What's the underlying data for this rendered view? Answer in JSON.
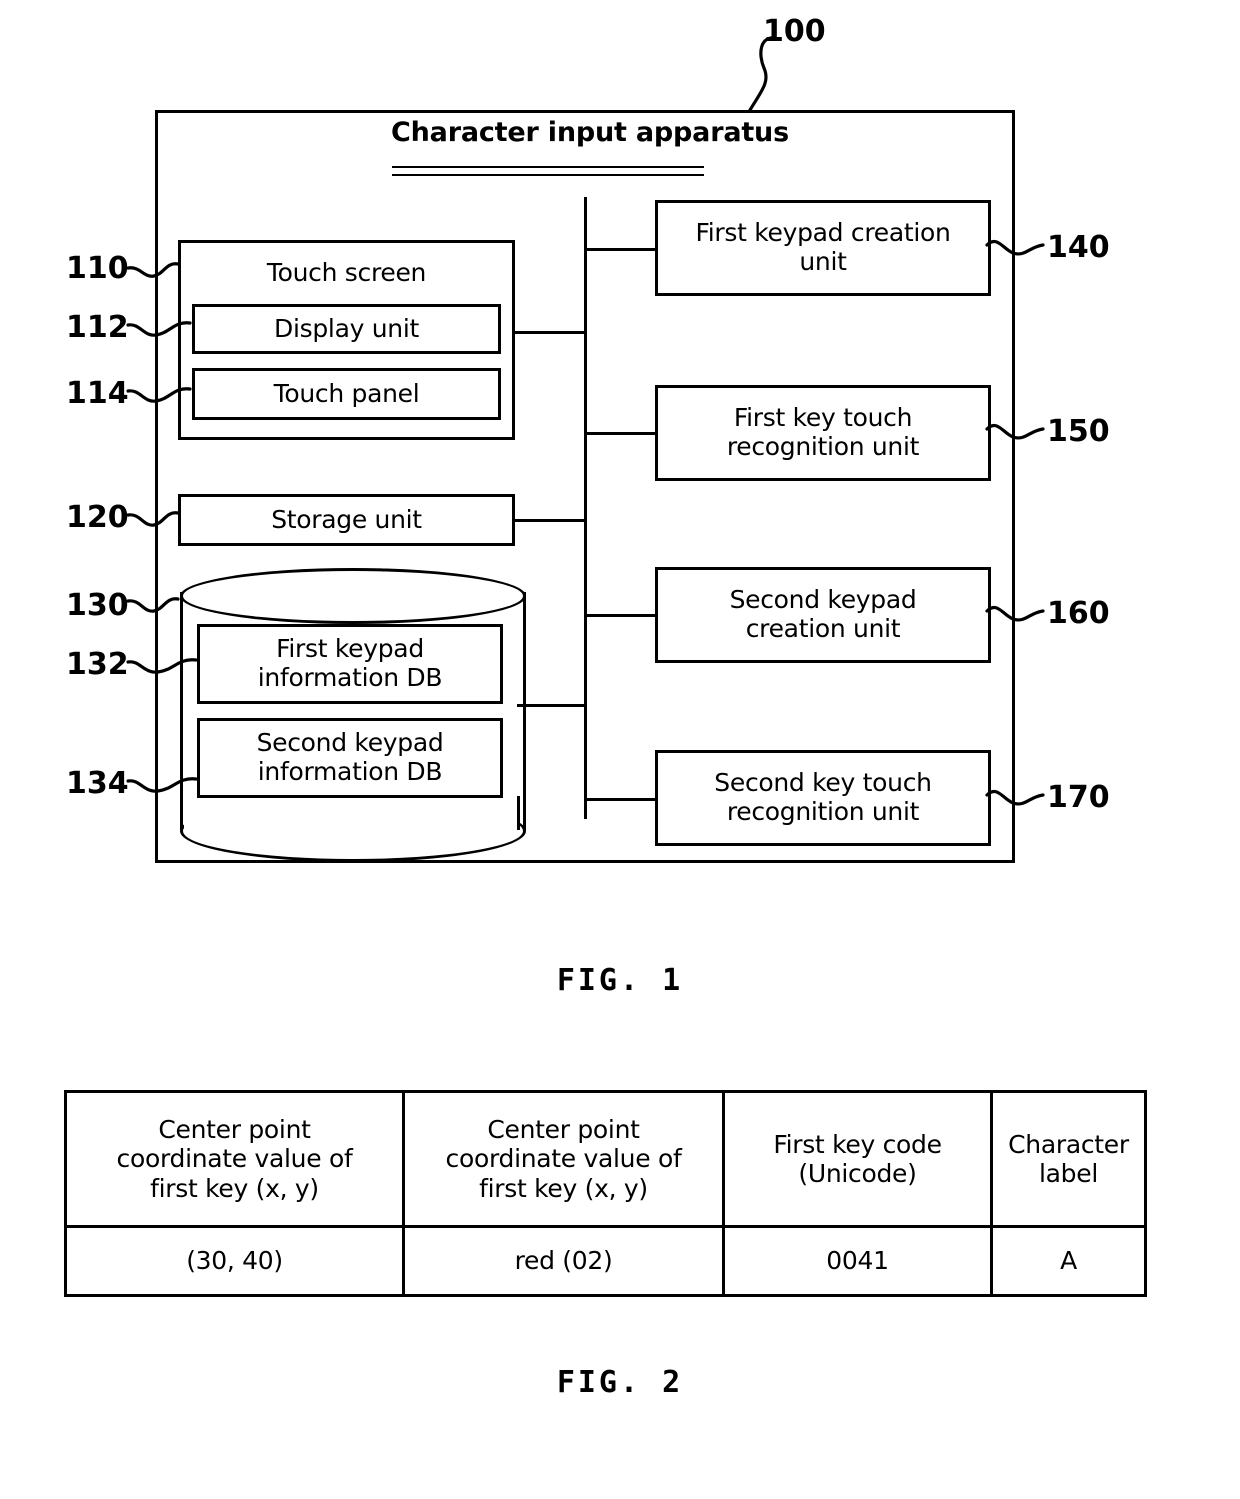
{
  "figure1": {
    "caption": "FIG. 1",
    "apparatus": {
      "title": "Character input apparatus",
      "ref": "100"
    },
    "left_column": [
      {
        "ref": "110",
        "label": "Touch screen",
        "children": [
          {
            "ref": "112",
            "label": "Display unit"
          },
          {
            "ref": "114",
            "label": "Touch panel"
          }
        ]
      },
      {
        "ref": "120",
        "label": "Storage unit",
        "children": []
      },
      {
        "ref": "130",
        "label": "",
        "shape": "cylinder",
        "children": [
          {
            "ref": "132",
            "label": "First keypad information DB",
            "line1": "First keypad",
            "line2": "information DB"
          },
          {
            "ref": "134",
            "label": "Second keypad information DB",
            "line1": "Second keypad",
            "line2": "information DB"
          }
        ]
      }
    ],
    "right_column": [
      {
        "ref": "140",
        "label": "First keypad creation unit",
        "line1": "First keypad creation",
        "line2": "unit"
      },
      {
        "ref": "150",
        "label": "First key touch recognition unit",
        "line1": "First key touch",
        "line2": "recognition unit"
      },
      {
        "ref": "160",
        "label": "Second keypad creation unit",
        "line1": "Second keypad",
        "line2": "creation unit"
      },
      {
        "ref": "170",
        "label": "Second key touch recognition unit",
        "line1": "Second key touch",
        "line2": "recognition unit"
      }
    ]
  },
  "figure2": {
    "caption": "FIG. 2",
    "table": {
      "headers": [
        {
          "line1": "Center point",
          "line2": "coordinate value of",
          "line3": "first key (x, y)"
        },
        {
          "line1": "Center point",
          "line2": "coordinate value of",
          "line3": "first key (x, y)"
        },
        {
          "line1": "First key code",
          "line2": "(Unicode)",
          "line3": ""
        },
        {
          "line1": "Character",
          "line2": "label",
          "line3": ""
        }
      ],
      "rows": [
        [
          "(30, 40)",
          "red (02)",
          "0041",
          "A"
        ]
      ]
    }
  },
  "colors": {
    "ink": "#000000",
    "paper": "#ffffff"
  }
}
